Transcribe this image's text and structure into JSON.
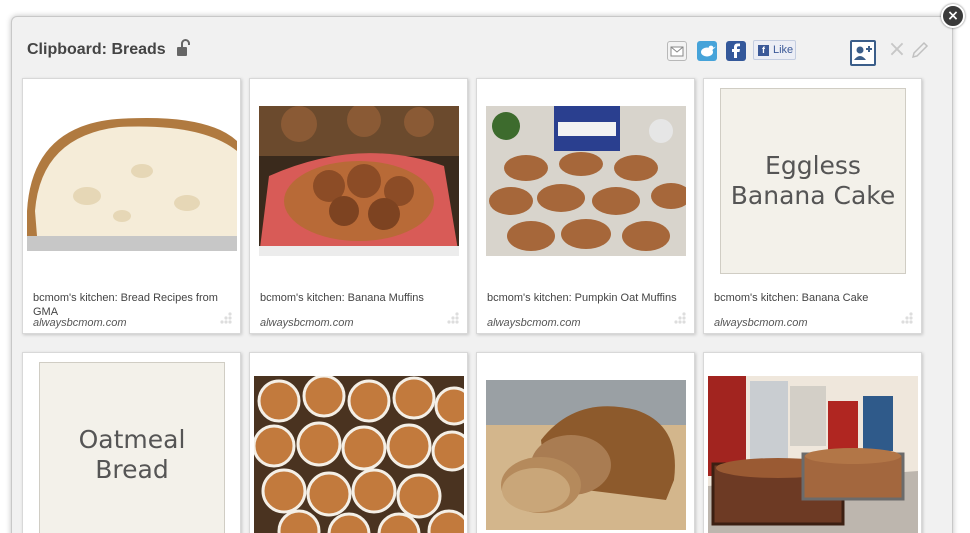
{
  "header": {
    "close_symbol": "×",
    "title": "Clipboard: Breads",
    "lock_icon": "unlock-icon",
    "like_label": "Like",
    "like_fb_glyph": "f",
    "delete_symbol": "×"
  },
  "colors": {
    "modal_bg": "#f1f1f1",
    "twitter": "#46a3d9",
    "facebook": "#34589a",
    "accent": "#3b5e8a"
  },
  "cards": [
    {
      "caption": "bcmom's kitchen: Bread Recipes from GMA",
      "source": "alwaysbcmom.com",
      "image": "bread-loaf-photo"
    },
    {
      "caption": "bcmom's kitchen: Banana Muffins",
      "source": "alwaysbcmom.com",
      "image": "banana-muffins-photo"
    },
    {
      "caption": "bcmom's kitchen: Pumpkin Oat Muffins",
      "source": "alwaysbcmom.com",
      "image": "pumpkin-oat-muffins-photo"
    },
    {
      "caption": "bcmom's kitchen: Banana Cake",
      "source": "alwaysbcmom.com",
      "text_image": "Eggless\nBanana Cake"
    },
    {
      "text_image": "Oatmeal\nBread"
    },
    {
      "image": "cinnamon-rolls-photo"
    },
    {
      "image": "sliced-bread-photo"
    },
    {
      "image": "bread-pans-photo"
    }
  ]
}
